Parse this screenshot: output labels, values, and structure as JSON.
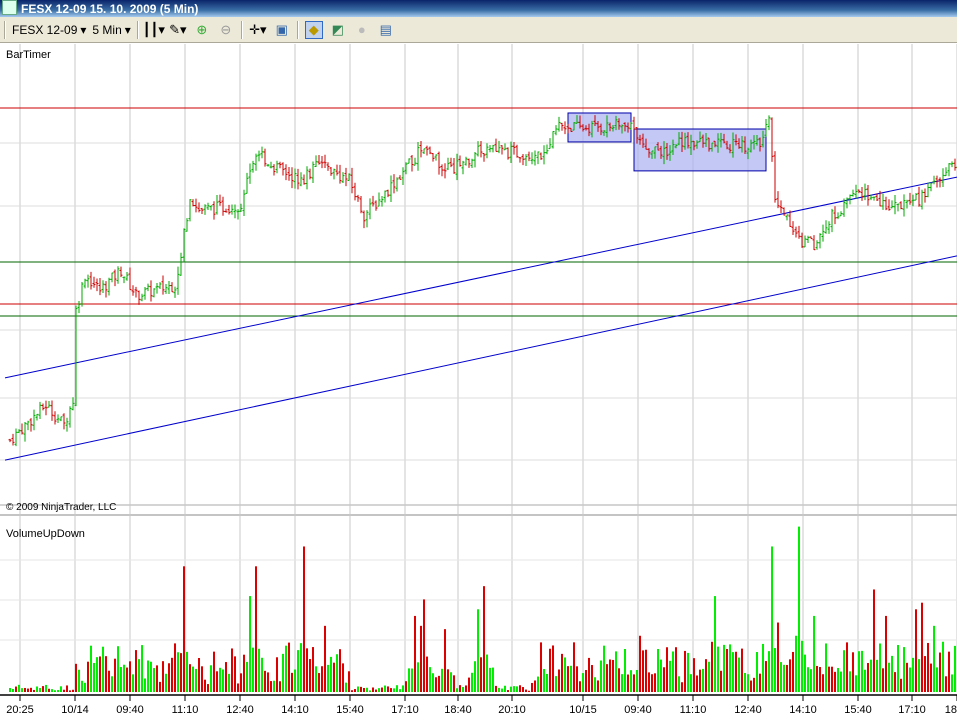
{
  "window": {
    "title": "FESX 12-09  15. 10. 2009 (5 Min)"
  },
  "toolbar": {
    "instrument": "FESX 12-09",
    "interval": "5 Min",
    "icons": [
      "bar-style-icon",
      "pencil-draw-icon",
      "zoom-in-icon",
      "zoom-out-icon",
      "crosshair-icon",
      "properties-icon",
      "strategy-icon",
      "chart-icon",
      "record-icon",
      "data-box-icon"
    ]
  },
  "colors": {
    "up": "#00aa00",
    "down": "#cc0000",
    "grid": "#c8c8c8",
    "trend": "#0000cc",
    "box_fill": "#aab0f0"
  },
  "chart_data": [
    {
      "type": "ohlc",
      "title": "BarTimer",
      "copyright": "© 2009 NinjaTrader, LLC",
      "ylim": [
        2750,
        2900
      ],
      "x_tick_labels": [
        "20:25",
        "10/14",
        "09:40",
        "11:10",
        "12:40",
        "14:10",
        "15:40",
        "17:10",
        "18:40",
        "20:10",
        "10/15",
        "09:40",
        "11:10",
        "12:40",
        "14:10",
        "15:40",
        "17:10",
        "18"
      ],
      "close_path": [
        [
          0,
          2772.7
        ],
        [
          12,
          2784.1
        ],
        [
          18,
          2777.6
        ],
        [
          21,
          2785.7
        ],
        [
          22,
          2814.9
        ],
        [
          25,
          2826.3
        ],
        [
          30,
          2821.4
        ],
        [
          37,
          2827.9
        ],
        [
          42,
          2819.8
        ],
        [
          55,
          2823.1
        ],
        [
          58,
          2839.3
        ],
        [
          60,
          2850.6
        ],
        [
          63,
          2847.4
        ],
        [
          77,
          2849.0
        ],
        [
          82,
          2866.9
        ],
        [
          87,
          2862.0
        ],
        [
          97,
          2857.1
        ],
        [
          103,
          2862.0
        ],
        [
          113,
          2857.1
        ],
        [
          118,
          2845.8
        ],
        [
          123,
          2850.6
        ],
        [
          130,
          2858.8
        ],
        [
          137,
          2866.9
        ],
        [
          147,
          2860.4
        ],
        [
          157,
          2866.9
        ],
        [
          177,
          2865.3
        ],
        [
          183,
          2875.0
        ],
        [
          190,
          2874.0
        ],
        [
          207,
          2875.0
        ],
        [
          210,
          2868.5
        ],
        [
          217,
          2865.3
        ],
        [
          223,
          2870.1
        ],
        [
          237,
          2868.5
        ],
        [
          250,
          2868.5
        ],
        [
          253,
          2876.0
        ],
        [
          255,
          2852.3
        ],
        [
          263,
          2837.7
        ],
        [
          268,
          2836.0
        ],
        [
          273,
          2844.2
        ],
        [
          283,
          2853.9
        ],
        [
          290,
          2849.0
        ],
        [
          303,
          2850.6
        ],
        [
          316,
          2863.6
        ]
      ],
      "horizontal_lines": [
        {
          "price": 2880.5,
          "color": "red"
        },
        {
          "price": 2816.9,
          "color": "red"
        },
        {
          "price": 2830.5,
          "color": "green"
        },
        {
          "price": 2813.0,
          "color": "green"
        }
      ],
      "trend_lines": [
        {
          "from": [
            0,
            2792.9
          ],
          "to": [
            316,
            2858.1
          ]
        },
        {
          "from": [
            0,
            2766.2
          ],
          "to": [
            316,
            2832.5
          ]
        }
      ],
      "rectangles": [
        {
          "bars": [
            186,
            207
          ],
          "prices": [
            2869.5,
            2878.9
          ]
        },
        {
          "bars": [
            208,
            252
          ],
          "prices": [
            2860.1,
            2873.7
          ]
        }
      ]
    },
    {
      "type": "bar",
      "title": "VolumeUpDown",
      "ylim": [
        0,
        6000
      ],
      "base_volume": 400,
      "spikes": [
        [
          58,
          3800
        ],
        [
          80,
          2900
        ],
        [
          82,
          3800
        ],
        [
          98,
          4400
        ],
        [
          105,
          2000
        ],
        [
          135,
          2300
        ],
        [
          137,
          2000
        ],
        [
          138,
          2800
        ],
        [
          145,
          1900
        ],
        [
          156,
          2500
        ],
        [
          158,
          3200
        ],
        [
          177,
          1500
        ],
        [
          205,
          1300
        ],
        [
          210,
          1700
        ],
        [
          216,
          1300
        ],
        [
          235,
          2900
        ],
        [
          239,
          1300
        ],
        [
          254,
          4400
        ],
        [
          256,
          2100
        ],
        [
          262,
          1700
        ],
        [
          263,
          5000
        ],
        [
          268,
          2300
        ],
        [
          279,
          1500
        ],
        [
          288,
          3100
        ],
        [
          292,
          2300
        ],
        [
          302,
          2500
        ],
        [
          304,
          2700
        ],
        [
          308,
          2000
        ]
      ]
    }
  ]
}
